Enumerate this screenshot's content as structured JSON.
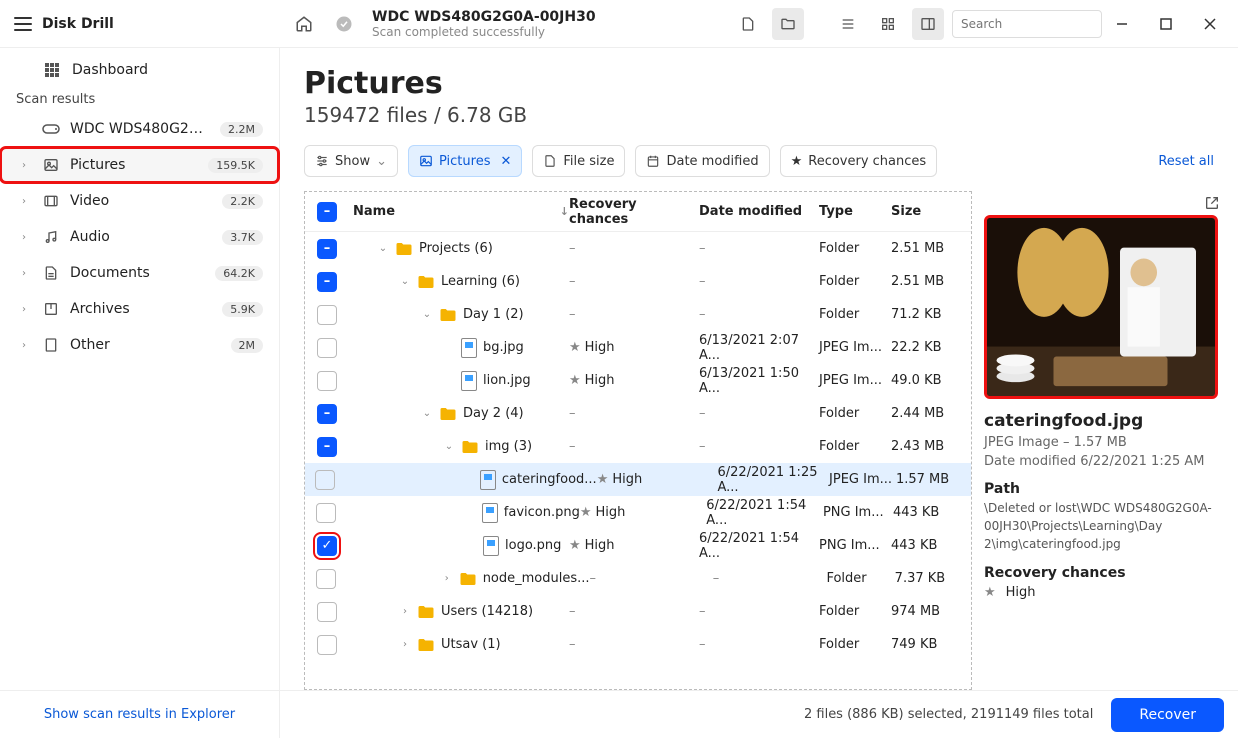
{
  "app": {
    "title": "Disk Drill"
  },
  "topbar": {
    "drive_name": "WDC WDS480G2G0A-00JH30",
    "scan_status": "Scan completed successfully",
    "search_placeholder": "Search"
  },
  "sidebar": {
    "dashboard": "Dashboard",
    "scan_results_header": "Scan results",
    "drive": {
      "label": "WDC WDS480G2G0A-0...",
      "count": "2.2M"
    },
    "categories": [
      {
        "key": "pictures",
        "label": "Pictures",
        "count": "159.5K",
        "highlight": true,
        "icon": "image"
      },
      {
        "key": "video",
        "label": "Video",
        "count": "2.2K",
        "icon": "video"
      },
      {
        "key": "audio",
        "label": "Audio",
        "count": "3.7K",
        "icon": "audio"
      },
      {
        "key": "documents",
        "label": "Documents",
        "count": "64.2K",
        "icon": "doc"
      },
      {
        "key": "archives",
        "label": "Archives",
        "count": "5.9K",
        "icon": "archive"
      },
      {
        "key": "other",
        "label": "Other",
        "count": "2M",
        "icon": "other"
      }
    ],
    "footer_link": "Show scan results in Explorer"
  },
  "page": {
    "title": "Pictures",
    "subtitle": "159472 files / 6.78 GB"
  },
  "filters": {
    "show": "Show",
    "pictures": "Pictures",
    "file_size": "File size",
    "date_modified": "Date modified",
    "recovery_chances": "Recovery chances",
    "reset": "Reset all"
  },
  "columns": {
    "name": "Name",
    "recovery": "Recovery chances",
    "date": "Date modified",
    "type": "Type",
    "size": "Size"
  },
  "rows": [
    {
      "indent": 0,
      "chk": "blue",
      "kind": "folder",
      "name": "Projects (6)",
      "rec": "–",
      "date": "–",
      "type": "Folder",
      "size": "2.51 MB",
      "exp": "down"
    },
    {
      "indent": 1,
      "chk": "blue",
      "kind": "folder",
      "name": "Learning (6)",
      "rec": "–",
      "date": "–",
      "type": "Folder",
      "size": "2.51 MB",
      "exp": "down"
    },
    {
      "indent": 2,
      "chk": "empty",
      "kind": "folder",
      "name": "Day 1 (2)",
      "rec": "–",
      "date": "–",
      "type": "Folder",
      "size": "71.2 KB",
      "exp": "down"
    },
    {
      "indent": 3,
      "chk": "empty",
      "kind": "file",
      "name": "bg.jpg",
      "rec": "High",
      "date": "6/13/2021 2:07 A...",
      "type": "JPEG Im...",
      "size": "22.2 KB"
    },
    {
      "indent": 3,
      "chk": "empty",
      "kind": "file",
      "name": "lion.jpg",
      "rec": "High",
      "date": "6/13/2021 1:50 A...",
      "type": "JPEG Im...",
      "size": "49.0 KB"
    },
    {
      "indent": 2,
      "chk": "blue",
      "kind": "folder",
      "name": "Day 2 (4)",
      "rec": "–",
      "date": "–",
      "type": "Folder",
      "size": "2.44 MB",
      "exp": "down"
    },
    {
      "indent": 3,
      "chk": "blue",
      "kind": "folder",
      "name": "img (3)",
      "rec": "–",
      "date": "–",
      "type": "Folder",
      "size": "2.43 MB",
      "exp": "down"
    },
    {
      "indent": 4,
      "chk": "empty",
      "kind": "file",
      "name": "cateringfood...",
      "rec": "High",
      "date": "6/22/2021 1:25 A...",
      "type": "JPEG Im...",
      "size": "1.57 MB",
      "sel": true
    },
    {
      "indent": 4,
      "chk": "empty",
      "kind": "file",
      "name": "favicon.png",
      "rec": "High",
      "date": "6/22/2021 1:54 A...",
      "type": "PNG Im...",
      "size": "443 KB"
    },
    {
      "indent": 4,
      "chk": "red",
      "kind": "file",
      "name": "logo.png",
      "rec": "High",
      "date": "6/22/2021 1:54 A...",
      "type": "PNG Im...",
      "size": "443 KB"
    },
    {
      "indent": 3,
      "chk": "empty",
      "kind": "folder",
      "name": "node_modules...",
      "rec": "–",
      "date": "–",
      "type": "Folder",
      "size": "7.37 KB",
      "exp": "right"
    },
    {
      "indent": 1,
      "chk": "empty",
      "kind": "folder",
      "name": "Users (14218)",
      "rec": "–",
      "date": "–",
      "type": "Folder",
      "size": "974 MB",
      "exp": "right"
    },
    {
      "indent": 1,
      "chk": "empty",
      "kind": "folder",
      "name": "Utsav (1)",
      "rec": "–",
      "date": "–",
      "type": "Folder",
      "size": "749 KB",
      "exp": "right"
    }
  ],
  "preview": {
    "filename": "cateringfood.jpg",
    "meta": "JPEG Image – 1.57 MB",
    "date": "Date modified 6/22/2021 1:25 AM",
    "path_label": "Path",
    "path": "\\Deleted or lost\\WDC WDS480G2G0A-00JH30\\Projects\\Learning\\Day 2\\img\\cateringfood.jpg",
    "recovery_label": "Recovery chances",
    "recovery_value": "High"
  },
  "footer": {
    "status": "2 files (886 KB) selected, 2191149 files total",
    "recover": "Recover"
  }
}
